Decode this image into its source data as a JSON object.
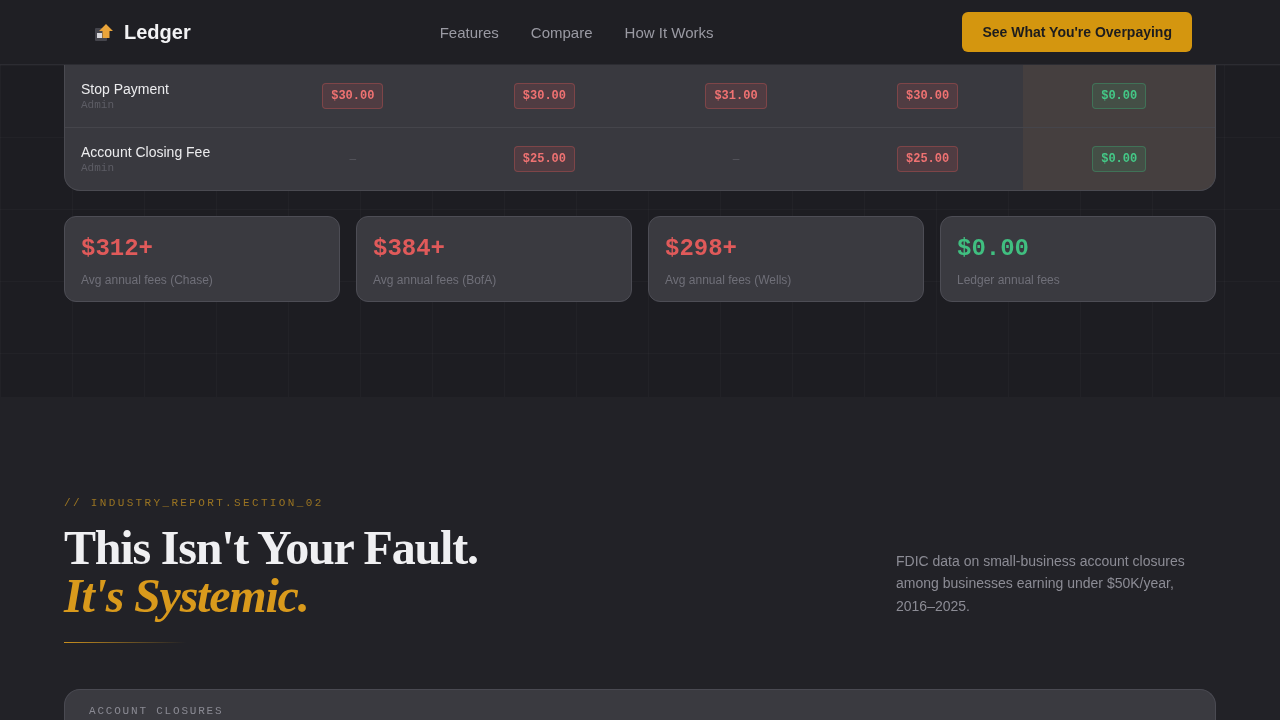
{
  "nav": {
    "brand": "Ledger",
    "links": [
      {
        "label": "Features"
      },
      {
        "label": "Compare"
      },
      {
        "label": "How It Works"
      }
    ],
    "cta": "See What You're Overpaying"
  },
  "fee_table": {
    "columns": [
      {
        "highlighted": false
      },
      {
        "highlighted": false
      },
      {
        "highlighted": false
      },
      {
        "highlighted": false
      },
      {
        "highlighted": true
      }
    ],
    "rows": [
      {
        "name": "Stop Payment",
        "category": "Admin",
        "cells": [
          {
            "kind": "fee",
            "text": "$30.00"
          },
          {
            "kind": "fee",
            "text": "$30.00"
          },
          {
            "kind": "fee",
            "text": "$31.00"
          },
          {
            "kind": "fee",
            "text": "$30.00"
          },
          {
            "kind": "free",
            "text": "$0.00"
          }
        ]
      },
      {
        "name": "Account Closing Fee",
        "category": "Admin",
        "cells": [
          {
            "kind": "none",
            "text": "—"
          },
          {
            "kind": "fee",
            "text": "$25.00"
          },
          {
            "kind": "none",
            "text": "—"
          },
          {
            "kind": "fee",
            "text": "$25.00"
          },
          {
            "kind": "free",
            "text": "$0.00"
          }
        ]
      }
    ]
  },
  "stats": [
    {
      "kind": "fee",
      "value": "$312+",
      "label": "Avg annual fees (Chase)"
    },
    {
      "kind": "fee",
      "value": "$384+",
      "label": "Avg annual fees (BofA)"
    },
    {
      "kind": "fee",
      "value": "$298+",
      "label": "Avg annual fees (Wells)"
    },
    {
      "kind": "free",
      "value": "$0.00",
      "label": "Ledger annual fees"
    }
  ],
  "report": {
    "eyebrow": "// INDUSTRY_REPORT.SECTION_02",
    "heading": "This Isn't Your Fault.",
    "heading_accent": "It's Systemic.",
    "description": "FDIC data on small-business account closures among businesses earning under $50K/year, 2016–2025.",
    "card": {
      "title": "ACCOUNT CLOSURES"
    }
  }
}
